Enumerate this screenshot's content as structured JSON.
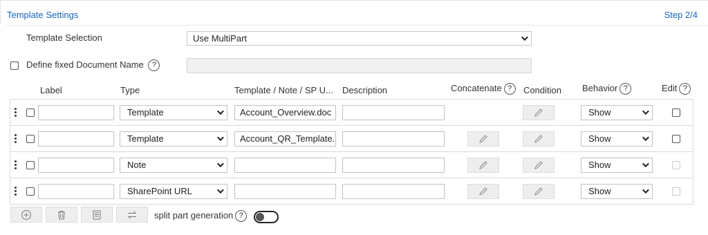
{
  "header": {
    "title": "Template Settings",
    "step": "Step 2/4"
  },
  "template_selection": {
    "label": "Template Selection",
    "value": "Use MultiPart"
  },
  "fixed_name": {
    "label": "Define fixed Document Name",
    "help": "?",
    "value": ""
  },
  "columns": {
    "label": "Label",
    "type": "Type",
    "template": "Template / Note / SP U...",
    "description": "Description",
    "concatenate": "Concatenate",
    "condition": "Condition",
    "behavior": "Behavior",
    "edit": "Edit",
    "help": "?"
  },
  "rows": [
    {
      "label": "",
      "type": "Template",
      "template": "Account_Overview.doc",
      "description": "",
      "behavior": "Show"
    },
    {
      "label": "",
      "type": "Template",
      "template": "Account_QR_Template.",
      "description": "",
      "behavior": "Show"
    },
    {
      "label": "",
      "type": "Note",
      "template": "",
      "description": "",
      "behavior": "Show"
    },
    {
      "label": "",
      "type": "SharePoint URL",
      "template": "",
      "description": "",
      "behavior": "Show"
    }
  ],
  "toolbar": {
    "split_label": "split part generation",
    "help": "?"
  },
  "colors": {
    "accent": "#1565c0"
  },
  "icons": [
    "plus-icon",
    "trash-icon",
    "template-icon",
    "swap-icon",
    "pencil-icon",
    "drag-handle-icon"
  ]
}
